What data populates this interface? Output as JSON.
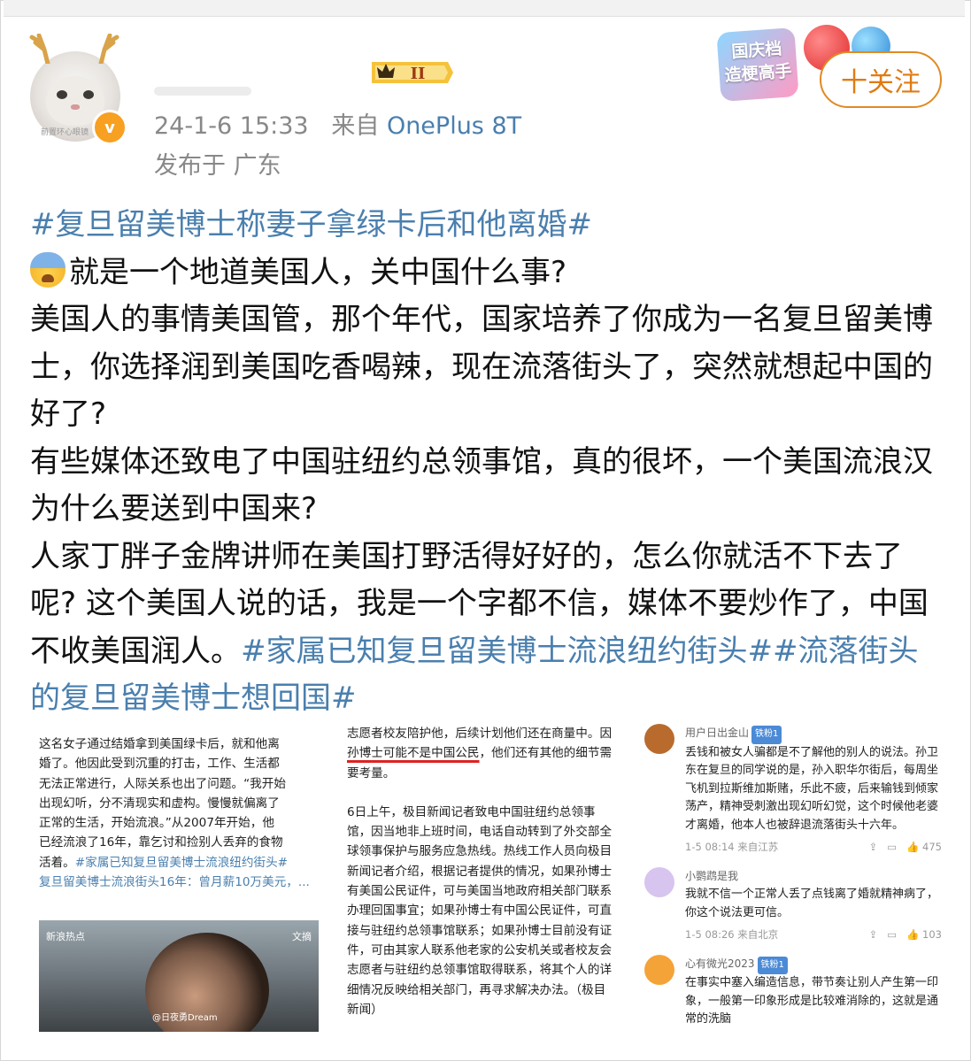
{
  "header": {
    "timestamp": "24-1-6 15:33",
    "from_prefix": "来自",
    "device": "OnePlus 8T",
    "location": "发布于 广东",
    "level_badge": "II",
    "avatar_caption": "前置环心眼镜",
    "verified_mark": "v",
    "promo": "国庆档\n造梗高手",
    "follow_label": "十关注"
  },
  "post": {
    "hashtag_title": "#复旦留美博士称妻子拿绿卡后和他离婚#",
    "line1": "就是一个地道美国人，关中国什么事?",
    "para1": "美国人的事情美国管，那个年代，国家培养了你成为一名复旦留美博士，你选择润到美国吃香喝辣，现在流落街头了，突然就想起中国的好了?",
    "para2": "有些媒体还致电了中国驻纽约总领事馆，真的很坏，一个美国流浪汉为什么要送到中国来?",
    "para3": "人家丁胖子金牌讲师在美国打野活得好好的，怎么你就活不下去了呢? 这个美国人说的话，我是一个字都不信，媒体不要炒作了，中国不收美国润人。",
    "tag2": "#家属已知复旦留美博士流浪纽约街头#",
    "tag3": "#流落街头的复旦留美博士想回国#"
  },
  "shot1": {
    "lines": [
      "这名女子通过结婚拿到美国绿卡后，就和他离",
      "婚了。他因此受到沉重的打击，工作、生活都",
      "无法正常进行，人际关系也出了问题。“我开始",
      "出现幻听，分不清现实和虚构。慢慢就偏离了",
      "正常的生活，开始流浪。”从2007年开始，他",
      "已经流浪了16年，靠乞讨和捡别人丢弃的食物",
      "活着。"
    ],
    "tag": "#家属已知复旦留美博士流浪纽约街头#",
    "link": "复旦留美博士流浪街头16年：曾月薪10万美元，...",
    "video_logo": "新浪热点",
    "video_tag": "文摘",
    "video_watermark": "@日夜勇Dream"
  },
  "shot2": {
    "p1_pre": "志愿者校友陪护他，后续计划他们还在商量中。因",
    "p1_underlined": "孙博士可能不是中国公民",
    "p1_post": "，他们还有其他的细节需要考量。",
    "p2": "6日上午，极目新闻记者致电中国驻纽约总领事馆，因当地非上班时间，电话自动转到了外交部全球领事保护与服务应急热线。热线工作人员向极目新闻记者介绍，根据记者提供的情况，如果孙博士有美国公民证件，可与美国当地政府相关部门联系办理回国事宜；如果孙博士有中国公民证件，可直接与驻纽约总领事馆联系；如果孙博士目前没有证件，可由其家人联系他老家的公安机关或者校友会志愿者与驻纽约总领事馆取得联系，将其个人的详细情况反映给相关部门，再寻求解决办法。（极目新闻）"
  },
  "comments": [
    {
      "name": "用户日出金山",
      "tag": "铁粉1",
      "text": "丢钱和被女人骗都是不了解他的别人的说法。孙卫东在复旦的同学说的是，孙入职华尔街后，每周坐飞机到拉斯维加斯赌，乐此不疲，后来输钱到倾家荡产，精神受刺激出现幻听幻觉，这个时候他老婆才离婚，他本人也被辞退流落街头十六年。",
      "meta": "1-5 08:14 来自江苏",
      "likes": "475",
      "avatar_color": "#b96b2e"
    },
    {
      "name": "小鹦鹉是我",
      "tag": "",
      "text": "我就不信一个正常人丢了点钱离了婚就精神病了，你这个说法更可信。",
      "meta": "1-5 08:26 来自北京",
      "likes": "103",
      "avatar_color": "#d7c4ef"
    },
    {
      "name": "心有微光2023",
      "tag": "铁粉1",
      "text": "在事实中塞入编造信息，带节奏让别人产生第一印象，一般第一印象形成是比较难消除的，这就是通常的洗脑",
      "meta": "",
      "likes": "",
      "avatar_color": "#f4a339"
    }
  ]
}
